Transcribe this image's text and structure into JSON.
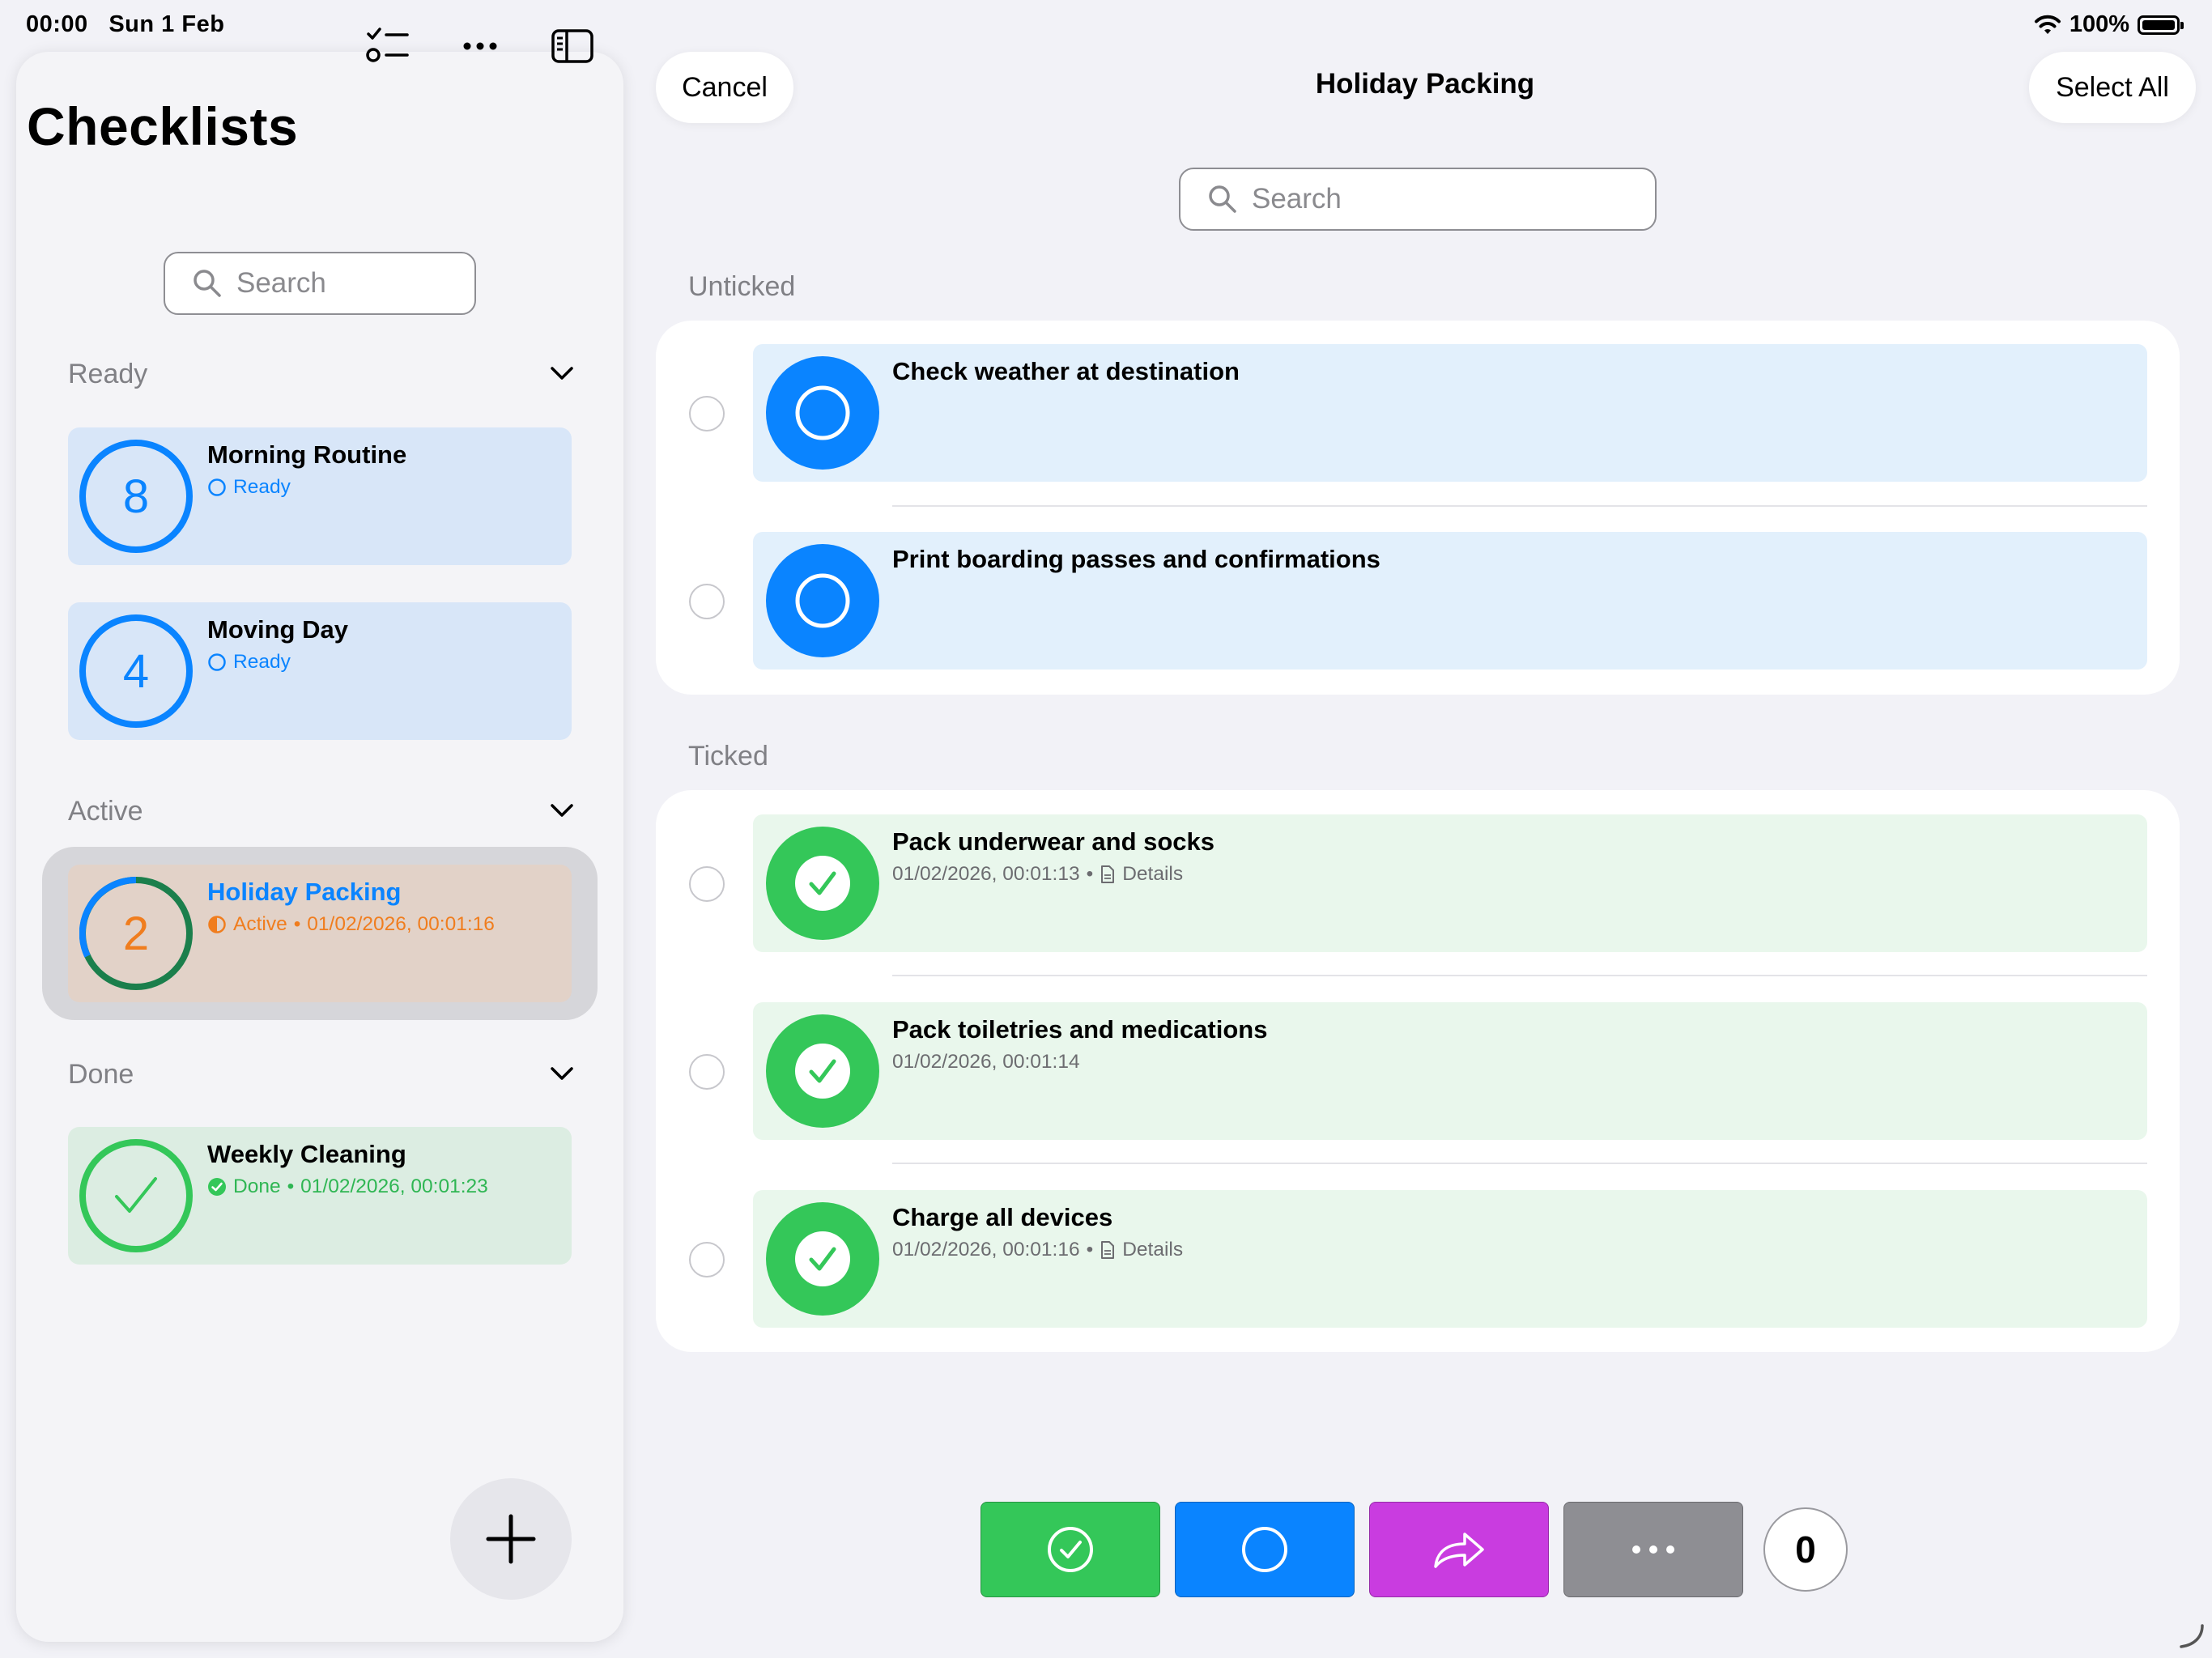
{
  "status_bar": {
    "time": "00:00",
    "date": "Sun 1 Feb",
    "battery": "100%"
  },
  "sidebar": {
    "title": "Checklists",
    "search_placeholder": "Search",
    "sections": [
      {
        "label": "Ready",
        "items": [
          {
            "count": "8",
            "title": "Morning Routine",
            "status": "Ready"
          },
          {
            "count": "4",
            "title": "Moving Day",
            "status": "Ready"
          }
        ]
      },
      {
        "label": "Active",
        "items": [
          {
            "count": "2",
            "title": "Holiday Packing",
            "status": "Active",
            "timestamp": "01/02/2026, 00:01:16"
          }
        ]
      },
      {
        "label": "Done",
        "items": [
          {
            "title": "Weekly Cleaning",
            "status": "Done",
            "timestamp": "01/02/2026, 00:01:23"
          }
        ]
      }
    ]
  },
  "main": {
    "cancel_label": "Cancel",
    "title": "Holiday Packing",
    "select_all_label": "Select All",
    "search_placeholder": "Search",
    "untick_label": "Unticked",
    "tick_label": "Ticked",
    "unticked": [
      {
        "title": "Check weather at destination"
      },
      {
        "title": "Print boarding passes and confirmations"
      }
    ],
    "ticked": [
      {
        "title": "Pack underwear and socks",
        "timestamp": "01/02/2026, 00:01:13",
        "details": "Details"
      },
      {
        "title": "Pack toiletries and medications",
        "timestamp": "01/02/2026, 00:01:14"
      },
      {
        "title": "Charge all devices",
        "timestamp": "01/02/2026, 00:01:16",
        "details": "Details"
      }
    ],
    "selected_count": "0",
    "separator": "•"
  },
  "colors": {
    "blue": "#0a84ff",
    "green": "#34c759",
    "purple": "#c93ce0",
    "gray": "#8e8e93",
    "orange": "#f07d1e"
  }
}
